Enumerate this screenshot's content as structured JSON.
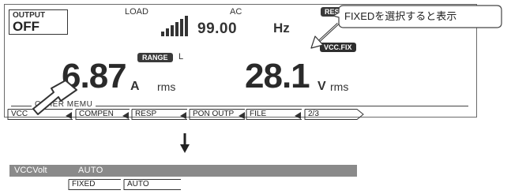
{
  "display": {
    "output_label": "OUTPUT",
    "output_value": "OFF",
    "load_label": "LOAD",
    "ac_label": "AC",
    "resp_badge": "RESP.M",
    "frequency_value": "99.00",
    "frequency_unit": "Hz",
    "vcc_badge": "VCC.FIX",
    "range_badge": "RANGE",
    "range_suffix": "L",
    "current_value": "6.87",
    "current_unit": "A",
    "current_mode": "rms",
    "voltage_value": "28.1",
    "voltage_unit": "V",
    "voltage_mode": "rms",
    "menu_title": "OTHER MEMU"
  },
  "softkeys": [
    "VCC",
    "COMPEN",
    "RESP",
    "PON OUTP",
    "FILE",
    "2/3"
  ],
  "callout": {
    "text": "FIXEDを選択すると表示"
  },
  "submenu": {
    "label": "VCCVolt",
    "value": "AUTO",
    "options": [
      "FIXED",
      "AUTO"
    ]
  },
  "colors": {
    "badge": "#3a3a3a",
    "submenu_bar": "#8a8a8a",
    "border": "#6a6a6a"
  }
}
